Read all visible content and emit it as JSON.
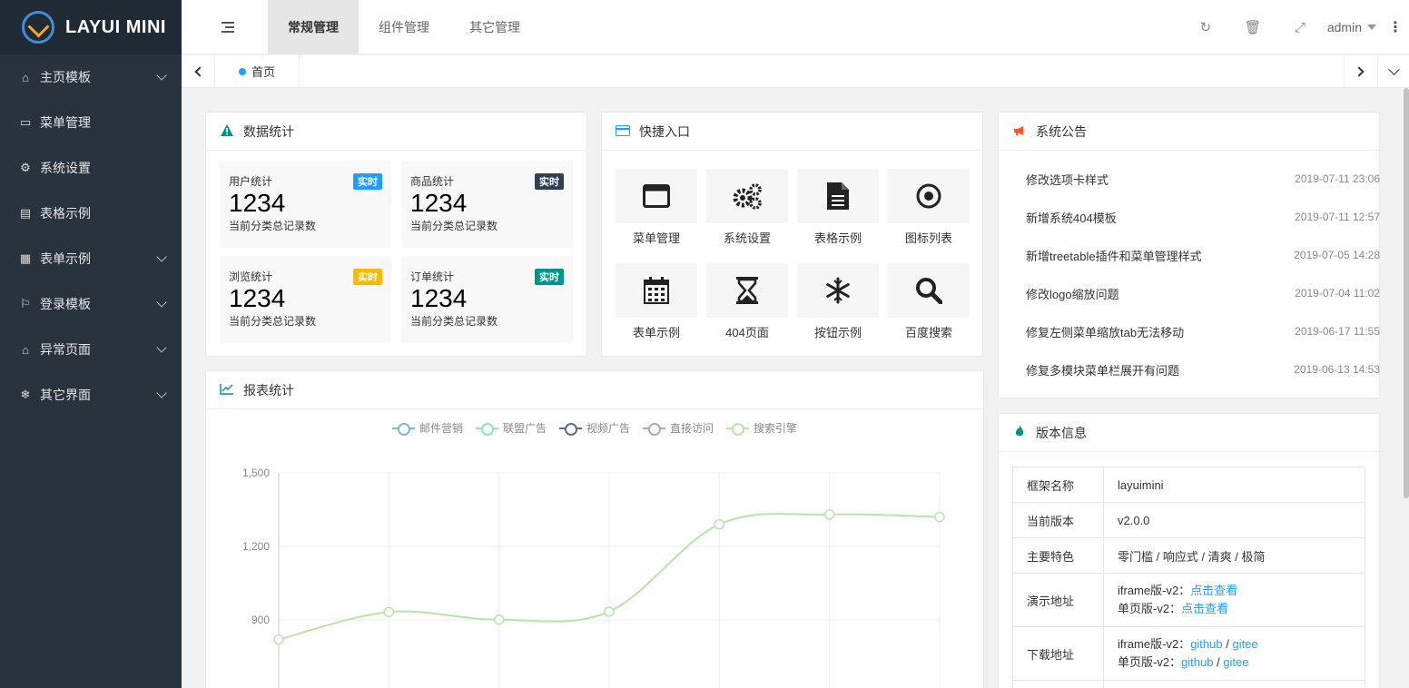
{
  "app": {
    "title": "LAYUI MINI"
  },
  "sidebar": {
    "items": [
      {
        "label": "主页模板",
        "icon": "home-icon",
        "glyph": "⌂",
        "has_children": true
      },
      {
        "label": "菜单管理",
        "icon": "window-icon",
        "glyph": "▭",
        "has_children": false
      },
      {
        "label": "系统设置",
        "icon": "gears-icon",
        "glyph": "⚙",
        "has_children": false
      },
      {
        "label": "表格示例",
        "icon": "file-icon",
        "glyph": "▤",
        "has_children": false
      },
      {
        "label": "表单示例",
        "icon": "calendar-icon",
        "glyph": "▦",
        "has_children": true
      },
      {
        "label": "登录模板",
        "icon": "flag-icon",
        "glyph": "⚐",
        "has_children": true
      },
      {
        "label": "异常页面",
        "icon": "home-icon",
        "glyph": "⌂",
        "has_children": true
      },
      {
        "label": "其它界面",
        "icon": "snowflake-icon",
        "glyph": "❄",
        "has_children": true
      }
    ]
  },
  "header": {
    "tabs": [
      {
        "label": "常规管理",
        "active": true
      },
      {
        "label": "组件管理",
        "active": false
      },
      {
        "label": "其它管理",
        "active": false
      }
    ],
    "user": "admin",
    "icons": {
      "refresh": "↻",
      "clear": "🗑",
      "fullscreen": "⤢",
      "more": "⋮"
    }
  },
  "tabbar": {
    "home_label": "首页"
  },
  "stats": {
    "title": "数据统计",
    "items": [
      {
        "title": "用户统计",
        "badge": "实时",
        "badge_color": "#1e9fff",
        "value": "1234",
        "desc": "当前分类总记录数"
      },
      {
        "title": "商品统计",
        "badge": "实时",
        "badge_color": "#2f4056",
        "value": "1234",
        "desc": "当前分类总记录数"
      },
      {
        "title": "浏览统计",
        "badge": "实时",
        "badge_color": "#ffb800",
        "value": "1234",
        "desc": "当前分类总记录数"
      },
      {
        "title": "订单统计",
        "badge": "实时",
        "badge_color": "#009688",
        "value": "1234",
        "desc": "当前分类总记录数"
      }
    ]
  },
  "quick": {
    "title": "快捷入口",
    "items": [
      {
        "label": "菜单管理",
        "icon": "window-icon"
      },
      {
        "label": "系统设置",
        "icon": "gears-icon"
      },
      {
        "label": "表格示例",
        "icon": "file-icon"
      },
      {
        "label": "图标列表",
        "icon": "dot-circle-icon"
      },
      {
        "label": "表单示例",
        "icon": "calendar-icon"
      },
      {
        "label": "404页面",
        "icon": "hourglass-icon"
      },
      {
        "label": "按钮示例",
        "icon": "snowflake-icon"
      },
      {
        "label": "百度搜索",
        "icon": "search-icon"
      }
    ]
  },
  "notice": {
    "title": "系统公告",
    "items": [
      {
        "text": "修改选项卡样式",
        "time": "2019-07-11 23:06"
      },
      {
        "text": "新增系统404模板",
        "time": "2019-07-11 12:57"
      },
      {
        "text": "新增treetable插件和菜单管理样式",
        "time": "2019-07-05 14:28"
      },
      {
        "text": "修改logo缩放问题",
        "time": "2019-07-04 11:02"
      },
      {
        "text": "修复左侧菜单缩放tab无法移动",
        "time": "2019-06-17 11:55"
      },
      {
        "text": "修复多模块菜单栏展开有问题",
        "time": "2019-06-13 14:53"
      }
    ]
  },
  "version": {
    "title": "版本信息",
    "rows": [
      {
        "key": "框架名称",
        "value": "layuimini"
      },
      {
        "key": "当前版本",
        "value": "v2.0.0"
      },
      {
        "key": "主要特色",
        "value": "零门槛 / 响应式 / 清爽 / 极简"
      }
    ],
    "demo": {
      "key": "演示地址",
      "line1_prefix": "iframe版-v2：",
      "line1_link": "点击查看",
      "line2_prefix": "单页版-v2：",
      "line2_link": "点击查看"
    },
    "download": {
      "key": "下载地址",
      "line1_prefix": "iframe版-v2：",
      "line2_prefix": "单页版-v2：",
      "github": "github",
      "gitee": "gitee",
      "sep": " / "
    }
  },
  "report": {
    "title": "报表统计"
  },
  "chart_data": {
    "type": "line",
    "legend": [
      {
        "name": "邮件营销",
        "color": "#7ab8e0"
      },
      {
        "name": "联盟广告",
        "color": "#91e0c8"
      },
      {
        "name": "视频广告",
        "color": "#5b6b8a"
      },
      {
        "name": "直接访问",
        "color": "#a8a4e6"
      },
      {
        "name": "搜索引擎",
        "color": "#b9e4a8"
      }
    ],
    "legend_placement": "top-center",
    "yticks": [
      "1,500",
      "1,200",
      "900"
    ],
    "ylim_visible": [
      600,
      1500
    ],
    "grid": true,
    "series": [
      {
        "name": "搜索引擎",
        "color": "#b9e4a8",
        "values": [
          820,
          932,
          901,
          934,
          1290,
          1330,
          1320
        ]
      }
    ]
  }
}
